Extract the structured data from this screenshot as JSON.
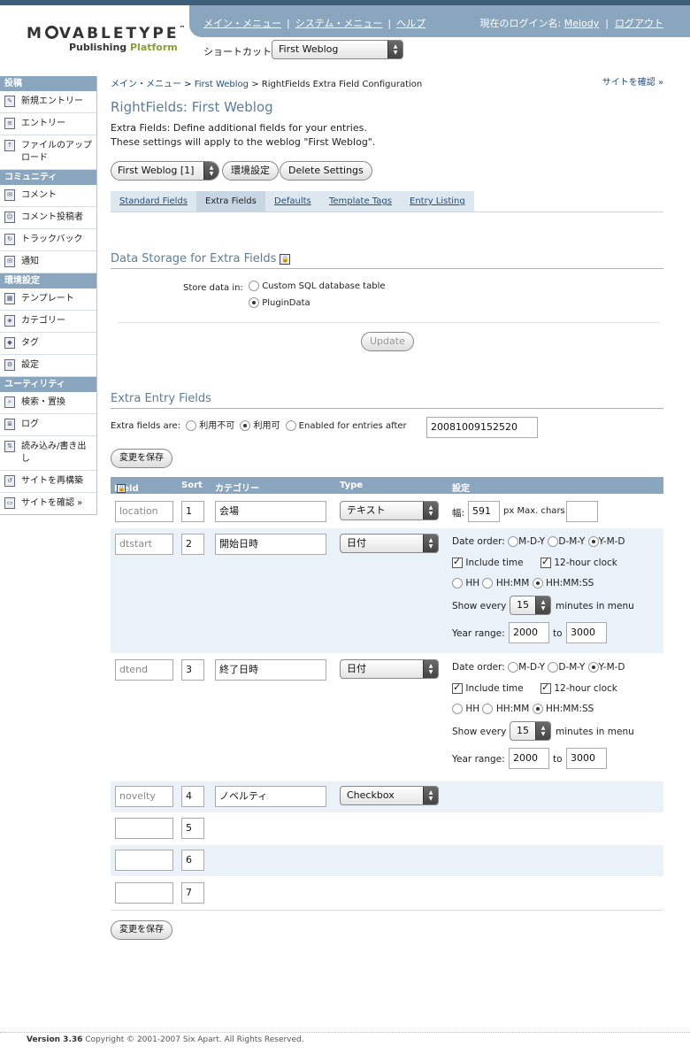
{
  "header": {
    "logo_main_a": "M",
    "logo_main_b": "VABLETYPE",
    "logo_tm": "™",
    "logo_sub_a": "Publishing ",
    "logo_sub_b": "Platform",
    "menu": [
      "メイン・メニュー",
      "システム・メニュー",
      "ヘルプ"
    ],
    "menu_sep": "|",
    "login_label": "現在のログイン名:",
    "username": "Melody",
    "logout": "ログアウト",
    "shortcut_label": "ショートカット:",
    "shortcut_value": "First Weblog"
  },
  "sidebar": {
    "sections": [
      {
        "title": "投稿",
        "items": [
          "新規エントリー",
          "エントリー",
          "ファイルのアップロード"
        ]
      },
      {
        "title": "コミュニティ",
        "items": [
          "コメント",
          "コメント投稿者",
          "トラックバック",
          "通知"
        ]
      },
      {
        "title": "環境設定",
        "items": [
          "テンプレート",
          "カテゴリー",
          "タグ",
          "設定"
        ]
      },
      {
        "title": "ユーティリティ",
        "items": [
          "検索・置換",
          "ログ",
          "読み込み/書き出し",
          "サイトを再構築",
          "サイトを確認 »"
        ]
      }
    ]
  },
  "main": {
    "breadcrumb": {
      "home": "メイン・メニュー",
      "sep": " > ",
      "blog": "First Weblog",
      "current": "RightFields Extra Field Configuration"
    },
    "view_site": "サイトを確認 »",
    "title": "RightFields: First Weblog",
    "desc1": "Extra Fields: Define additional fields for your entries.",
    "desc2": "These settings will apply to the weblog \"First Weblog\".",
    "blog_select": "First Weblog [1]",
    "settings_btn": "環境設定",
    "delete_btn": "Delete Settings",
    "tabs": [
      "Standard Fields",
      "Extra Fields",
      "Defaults",
      "Template Tags",
      "Entry Listing"
    ],
    "storage": {
      "title": "Data Storage for Extra Fields",
      "label": "Store data in:",
      "opt1": "Custom SQL database table",
      "opt2": "PluginData",
      "update_btn": "Update"
    },
    "extra": {
      "title": "Extra Entry Fields",
      "label": "Extra fields are:",
      "opt_disabled": "利用不可",
      "opt_enabled": "利用可",
      "opt_after": "Enabled for entries after",
      "after_value": "20081009152520",
      "save_btn": "変更を保存",
      "columns": [
        "Field",
        "Sort",
        "カテゴリー",
        "Type",
        "設定"
      ]
    },
    "rows": [
      {
        "field": "location",
        "sort": "1",
        "label": "会場",
        "type": "テキスト"
      },
      {
        "field": "dtstart",
        "sort": "2",
        "label": "開始日時",
        "type": "日付"
      },
      {
        "field": "dtend",
        "sort": "3",
        "label": "終了日時",
        "type": "日付"
      },
      {
        "field": "novelty",
        "sort": "4",
        "label": "ノベルティ",
        "type": "Checkbox"
      },
      {
        "field": "",
        "sort": "5"
      },
      {
        "field": "",
        "sort": "6"
      },
      {
        "field": "",
        "sort": "7"
      }
    ],
    "text_opts": {
      "width_label": "幅:",
      "width_value": "591",
      "px_label": "px Max. chars:",
      "max_value": ""
    },
    "date_opts": {
      "order_label": "Date order:",
      "orders": [
        "M-D-Y",
        "D-M-Y",
        "Y-M-D"
      ],
      "include_time": "Include time",
      "clock": "12-hour clock",
      "formats": [
        "HH",
        "HH:MM",
        "HH:MM:SS"
      ],
      "show_every": "Show every",
      "minutes_value": "15",
      "minutes_label": "minutes in menu",
      "year_range": "Year range:",
      "year_from": "2000",
      "year_to_label": "to",
      "year_to": "3000"
    }
  },
  "footer": {
    "version": "Version 3.36",
    "copyright": " Copyright © 2001-2007 Six Apart. All Rights Reserved."
  }
}
